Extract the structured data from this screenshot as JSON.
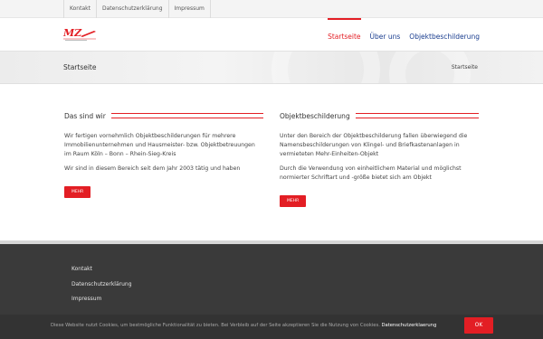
{
  "topbar": {
    "links": [
      "Kontakt",
      "Datenschutzerklärung",
      "Impressum"
    ]
  },
  "header": {
    "logo_alt": "MZ",
    "nav": [
      "Startseite",
      "Über uns",
      "Objektbeschilderung"
    ],
    "active_nav": "Startseite"
  },
  "titlebar": {
    "title": "Startseite",
    "breadcrumb": "Startseite"
  },
  "content": {
    "left": {
      "heading": "Das sind wir",
      "paragraphs": [
        "Wir fertigen vornehmlich Objektbeschilderungen für mehrere Immobilienunternehmen und Hausmeister- bzw. Objektbetreuungen im Raum Köln – Bonn – Rhein-Sieg-Kreis",
        "Wir sind in diesem Bereich seit dem Jahr 2003 tätig und haben"
      ],
      "button": "MEHR"
    },
    "right": {
      "heading": "Objektbeschilderung",
      "paragraphs": [
        "Unter den Bereich der Objektbeschilderung fallen überwiegend die Namensbeschilderungen von Klingel- und Briefkastenanlagen in vermieteten Mehr-Einheiten-Objekt",
        "Durch die Verwendung von einheitlichem Material und möglichst normierter Schriftart und -größe bietet sich am Objekt"
      ],
      "button": "MEHR"
    }
  },
  "footer": {
    "links": [
      "Kontakt",
      "Datenschutzerklärung",
      "Impressum"
    ]
  },
  "cookie": {
    "text": "Diese Website nutzt Cookies, um bestmögliche Funktionalität zu bieten. Bei Verbleib auf der Seite akzeptieren Sie die Nutzung von Cookies.",
    "link": "Datenschutzerklaerung",
    "button": "OK"
  },
  "colors": {
    "accent": "#e31e24",
    "nav": "#1a3d8f",
    "footer_bg": "#3a3a3a"
  }
}
